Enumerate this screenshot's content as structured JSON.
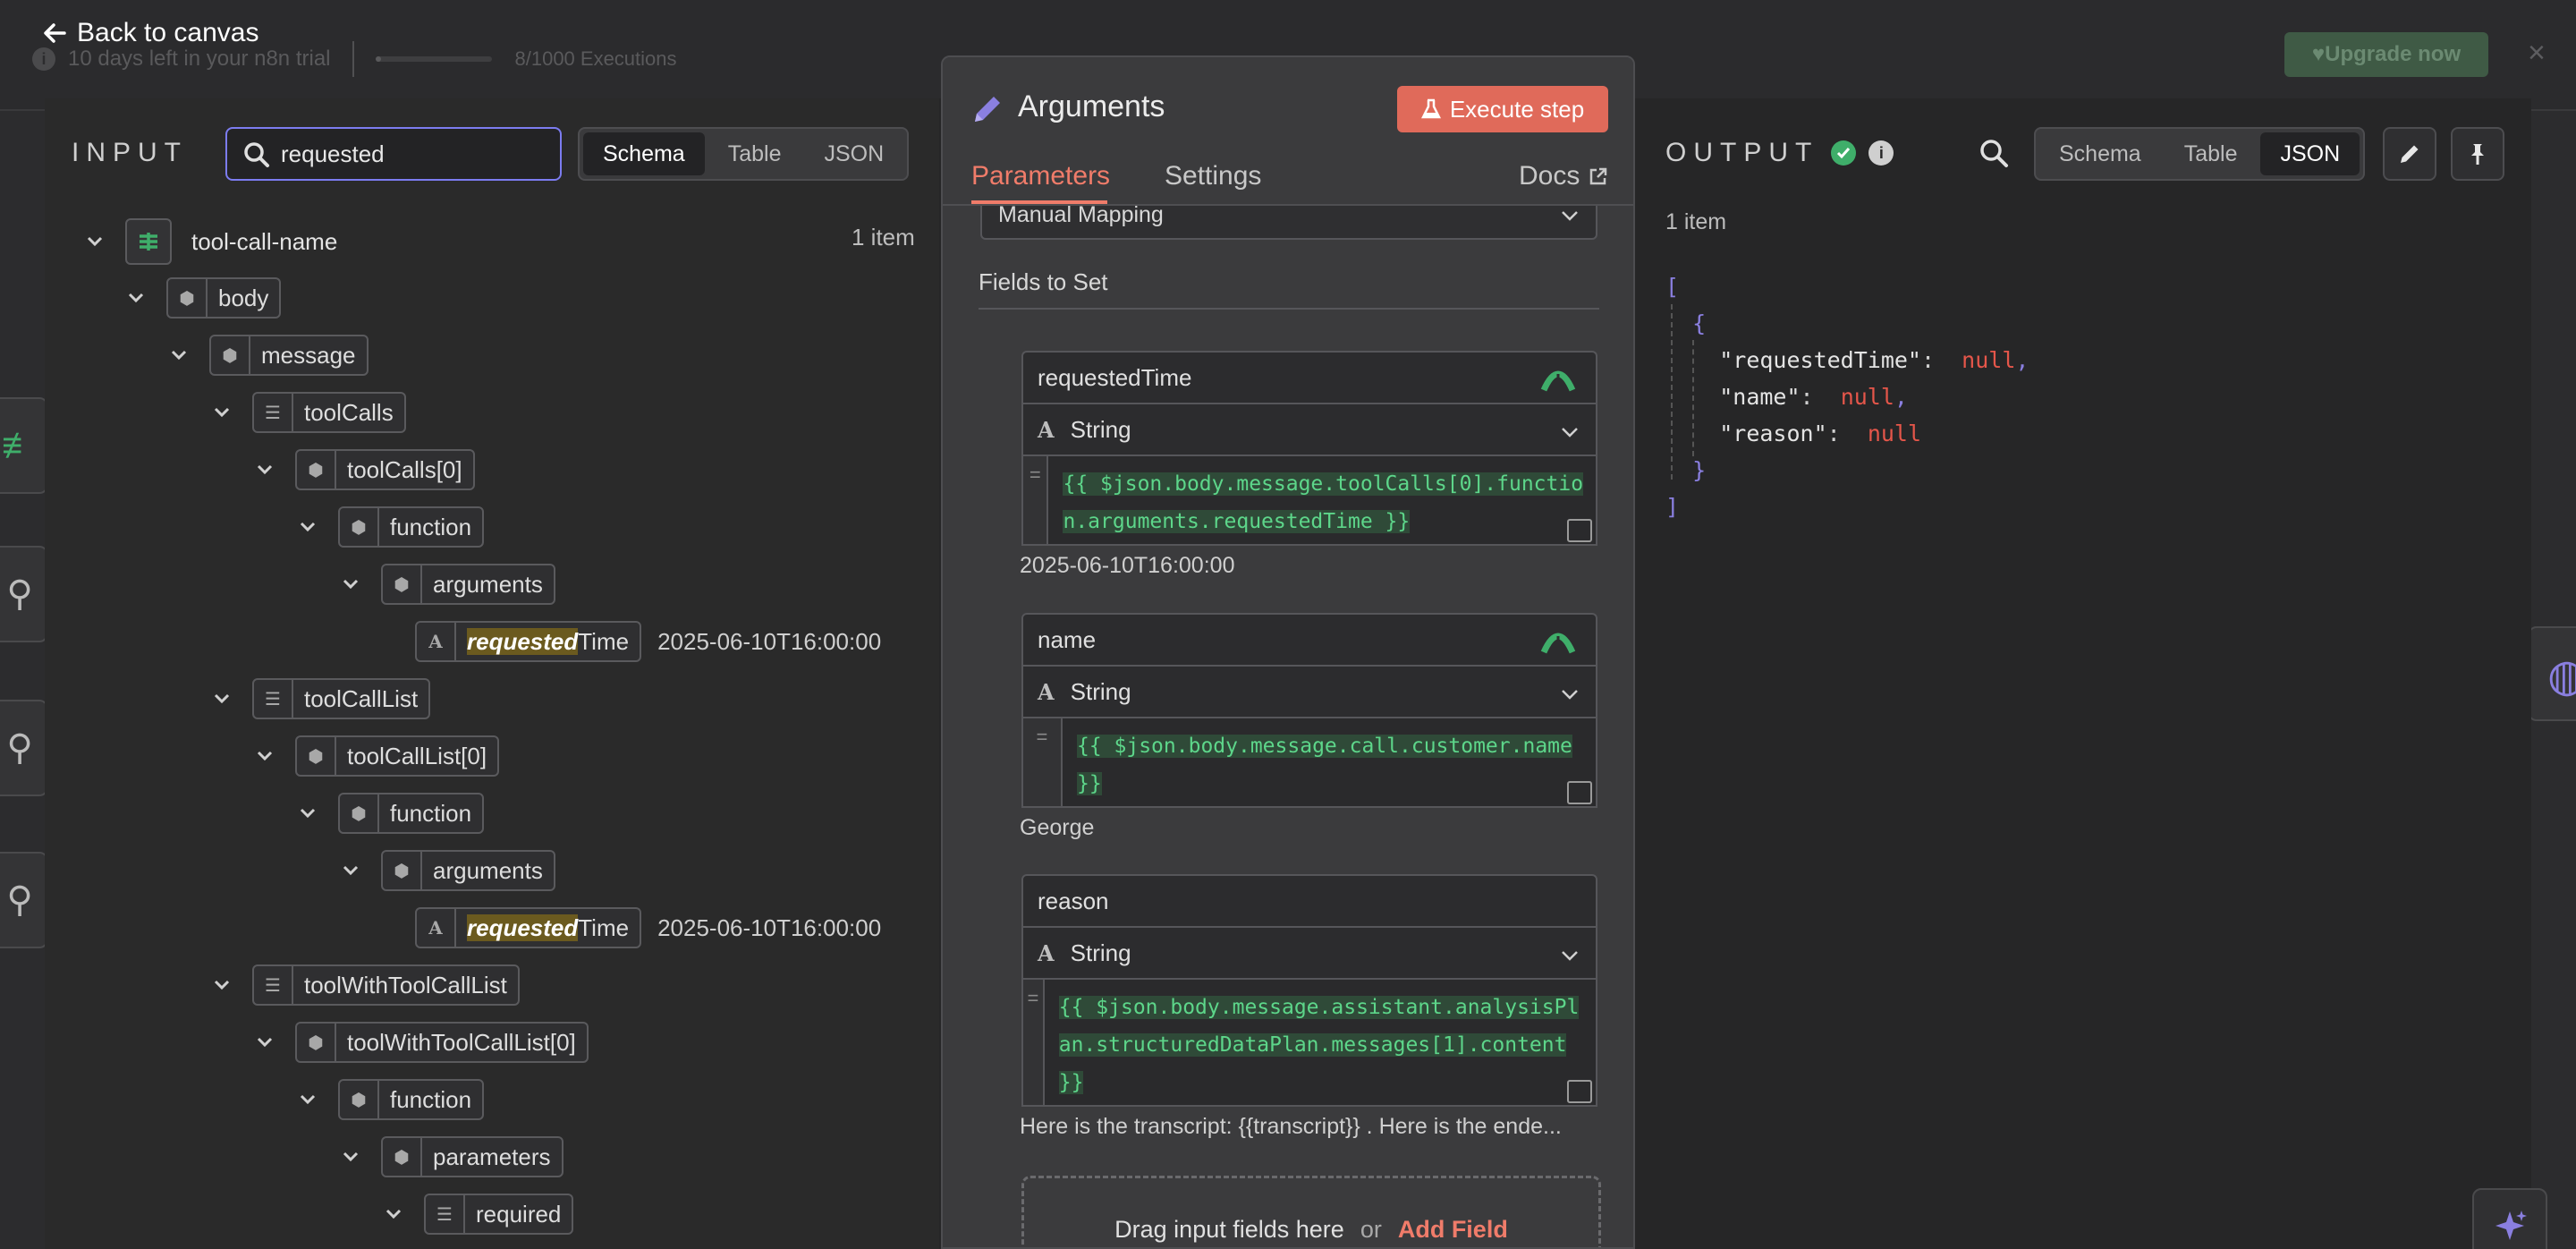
{
  "topbar": {
    "back_label": "Back to canvas",
    "trial_text": "10 days left in your n8n trial",
    "executions": "8/1000 Executions",
    "executions_used_fraction": 0.008,
    "upgrade_label": "Upgrade now",
    "close_label": "×"
  },
  "input": {
    "title": "INPUT",
    "search_value": "requested",
    "search_placeholder": "Search",
    "views": [
      "Schema",
      "Table",
      "JSON"
    ],
    "active_view": "Schema",
    "root_name": "tool-call-name",
    "root_count": "1 item",
    "tree": {
      "body": "body",
      "message": "message",
      "toolCalls": "toolCalls",
      "toolCalls0": "toolCalls[0]",
      "function1": "function",
      "arguments1": "arguments",
      "req1_hl": "requested",
      "req1_rest": "Time",
      "req1_val": "2025-06-10T16:00:00",
      "toolCallList": "toolCallList",
      "toolCallList0": "toolCallList[0]",
      "function2": "function",
      "arguments2": "arguments",
      "req2_hl": "requested",
      "req2_rest": "Time",
      "req2_val": "2025-06-10T16:00:00",
      "toolWithToolCallList": "toolWithToolCallList",
      "toolWithToolCallList0": "toolWithToolCallList[0]",
      "function3": "function",
      "parameters": "parameters",
      "required": "required"
    }
  },
  "node": {
    "title": "Arguments",
    "execute_label": "Execute step",
    "tabs": {
      "parameters": "Parameters",
      "settings": "Settings",
      "docs": "Docs"
    },
    "mode_value": "Manual Mapping",
    "fields_label": "Fields to Set",
    "fields": [
      {
        "name": "requestedTime",
        "type": "String",
        "expression": "{{ $json.body.message.toolCalls[0].function.arguments.requestedTime }}",
        "result": "2025-06-10T16:00:00"
      },
      {
        "name": "name",
        "type": "String",
        "expression": "{{ $json.body.message.call.customer.name }}",
        "result": "George"
      },
      {
        "name": "reason",
        "type": "String",
        "expression": "{{ $json.body.message.assistant.analysisPlan.structuredDataPlan.messages[1].content }}",
        "result": "Here is the transcript: {{transcript}} . Here is the ende..."
      }
    ],
    "drop_text": "Drag input fields here",
    "drop_or": "or",
    "add_field_label": "Add Field"
  },
  "output": {
    "title": "OUTPUT",
    "views": [
      "Schema",
      "Table",
      "JSON"
    ],
    "active_view": "JSON",
    "count": "1 item",
    "json": {
      "open_arr": "[",
      "open_obj": "{",
      "k1": "\"requestedTime\"",
      "k2": "\"name\"",
      "k3": "\"reason\"",
      "colon": ":",
      "null": "null",
      "comma": ",",
      "close_obj": "}",
      "close_arr": "]"
    }
  },
  "colors": {
    "accent": "#f07c6a",
    "execute_button": "#e06a5a",
    "search_focus": "#7c7cf0",
    "expression_green": "#5dd68a",
    "null_red": "#e5564a",
    "success": "#3fae6a"
  }
}
